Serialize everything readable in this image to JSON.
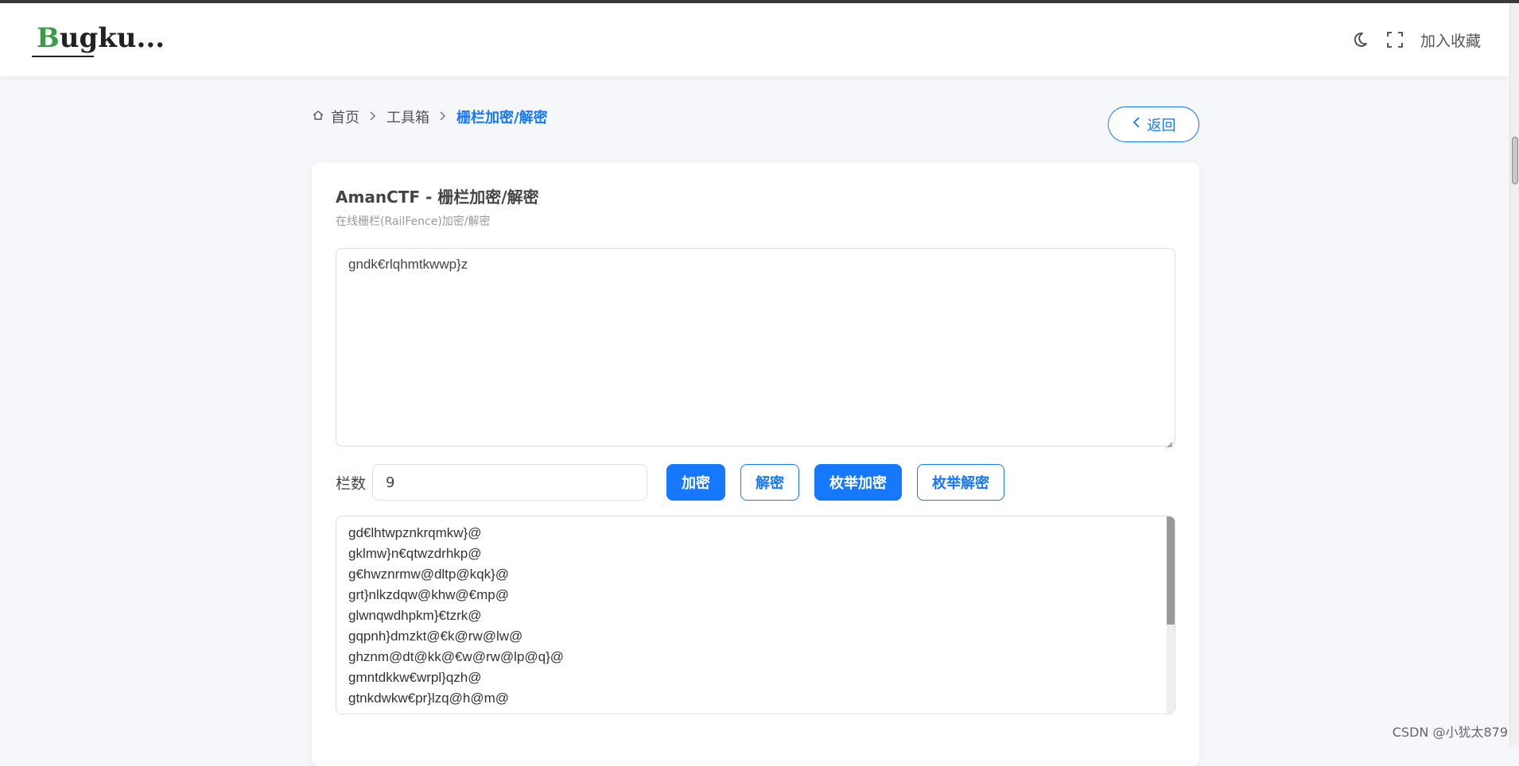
{
  "header": {
    "logo_text": "Bugku...",
    "favorite_label": "加入收藏",
    "icons": [
      "moon-icon",
      "fullscreen-icon"
    ]
  },
  "breadcrumb": {
    "home": "首页",
    "toolbox": "工具箱",
    "current": "栅栏加密/解密"
  },
  "back_label": "返回",
  "card": {
    "title": "AmanCTF - 栅栏加密/解密",
    "subtitle": "在线栅栏(RailFence)加密/解密",
    "input_value": "gndk€rlqhmtkwwp}z",
    "rails_label": "栏数",
    "rails_value": "9",
    "buttons": {
      "encrypt": "加密",
      "decrypt": "解密",
      "enum_encrypt": "枚举加密",
      "enum_decrypt": "枚举解密"
    },
    "output_lines": [
      "gd€lhtwpznkrqmkw}@",
      "gklmw}n€qtwzdrhkp@",
      "g€hwznrmw@dltp@kqk}@",
      "grt}nlkzdqw@khw@€mp@",
      "glwnqwdhpkm}€tzrk@",
      "gqpnh}dmzkt@€k@rw@lw@",
      "ghznm@dt@kk@€w@rw@lp@q}@",
      "gmntdkkw€wrpl}qzh@",
      "gtnkdwkw€pr}lzq@h@m@"
    ]
  },
  "watermark": "CSDN @小犹太879",
  "colors": {
    "accent": "#1677ff",
    "logo_green": "#3a9a4a",
    "background": "#f5f7fa"
  }
}
